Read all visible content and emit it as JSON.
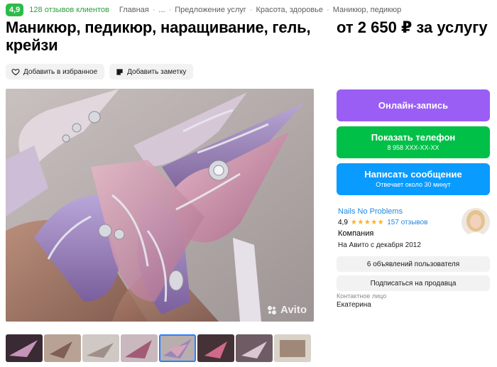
{
  "header": {
    "rating": "4,9",
    "reviews": "128 отзывов клиентов",
    "breadcrumbs": [
      "Главная",
      "...",
      "Предложение услуг",
      "Красота, здоровье",
      "Маникюр, педикюр"
    ]
  },
  "listing": {
    "title": "Маникюр, педикюр, наращивание, гель, крейзи",
    "price": "от 2 650 ₽ за услугу",
    "add_favorite": "Добавить в избранное",
    "add_note": "Добавить заметку",
    "watermark": "Avito"
  },
  "contact_buttons": {
    "book": "Онлайн-запись",
    "phone": "Показать телефон",
    "phone_number": "8 958 XXX-XX-XX",
    "message": "Написать сообщение",
    "message_sub": "Отвечает около 30 минут"
  },
  "seller": {
    "name": "Nails No Problems",
    "rating": "4,9",
    "stars": "★★★★★",
    "reviews": "157 отзывов",
    "type": "Компания",
    "since": "На Авито с декабря 2012",
    "user_listings": "6 объявлений пользователя",
    "subscribe": "Подписаться на продавца",
    "contact_label": "Контактное лицо",
    "contact_name": "Екатерина"
  },
  "gallery": {
    "thumbnail_count": 8,
    "active_index": 4
  },
  "colors": {
    "badge_green": "#2ebb4a",
    "purple": "#9b5ef5",
    "green": "#00c048",
    "blue": "#0a9bff",
    "link": "#1e88e5",
    "star": "#ffb021"
  }
}
